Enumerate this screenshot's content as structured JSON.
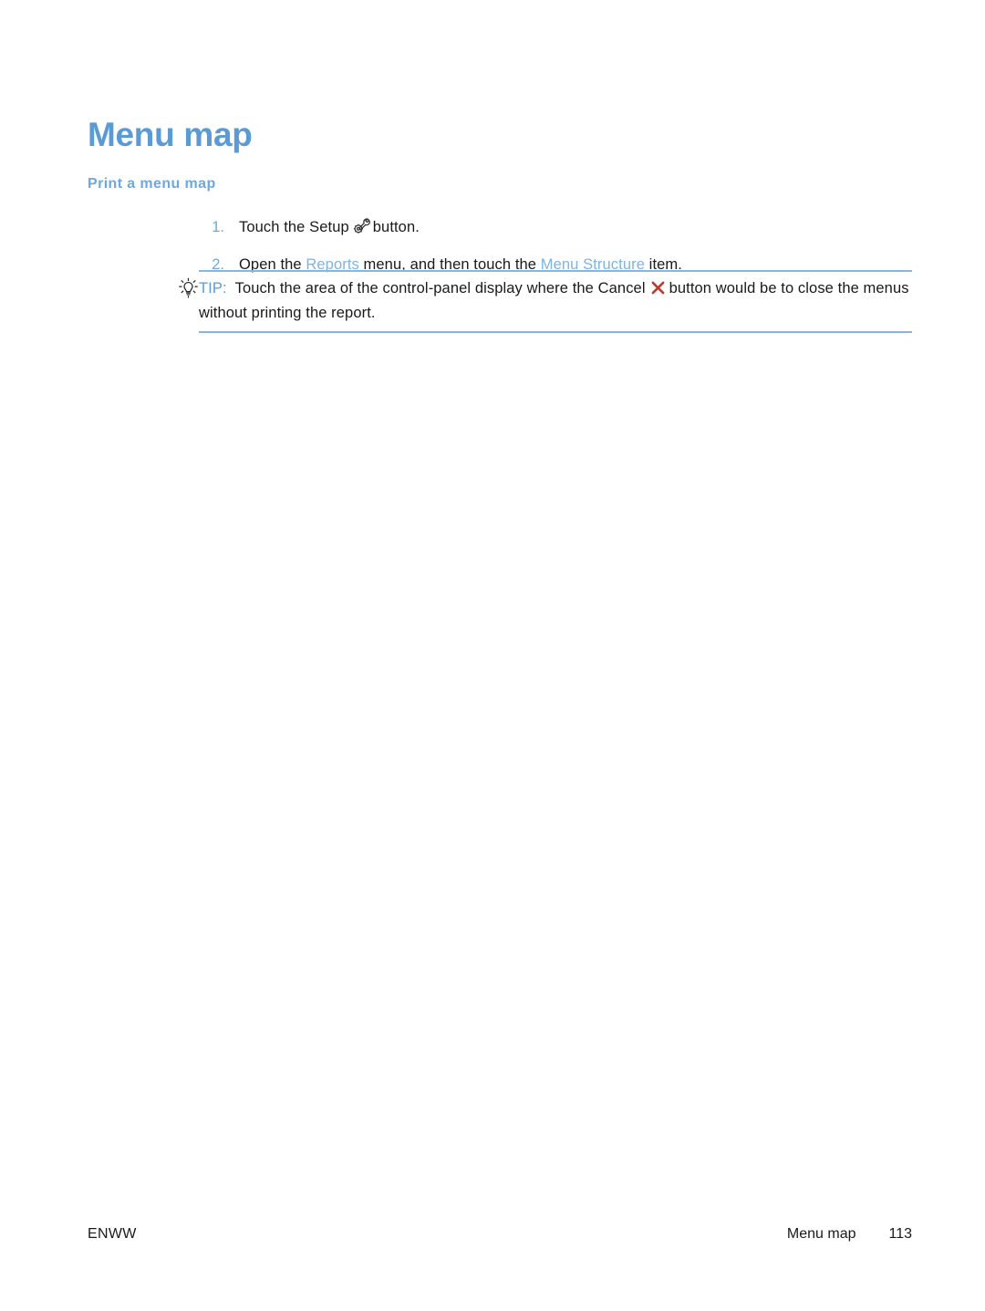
{
  "document": {
    "title": "Menu map",
    "section_subtitle": "Print a menu map"
  },
  "steps": [
    {
      "number": "1.",
      "text_before": "Touch the Setup",
      "icon": "setup-gear-wrench-icon",
      "text_after": "button."
    },
    {
      "number": "2.",
      "text_before": "Open the",
      "ui_ref_1": "Reports",
      "text_middle": "menu, and then touch the",
      "ui_ref_2": "Menu Structure",
      "text_after": "item."
    }
  ],
  "tip": {
    "icon": "lightbulb-icon",
    "label": "TIP:",
    "text_before": "Touch the area of the control-panel display where the Cancel",
    "inline_icon": "cancel-x-icon",
    "text_after": "button would be to close the menus without printing the report."
  },
  "footer": {
    "left": "ENWW",
    "chapter": "Menu map",
    "page_number": "113"
  },
  "colors": {
    "heading_blue": "#5b9bd5",
    "subtitle_blue": "#6fa8dc",
    "ui_ref_blue": "#7fb3e2",
    "rule_blue": "#8ab6de",
    "cancel_red": "#c0392b",
    "body_text": "#1a1a1a"
  }
}
